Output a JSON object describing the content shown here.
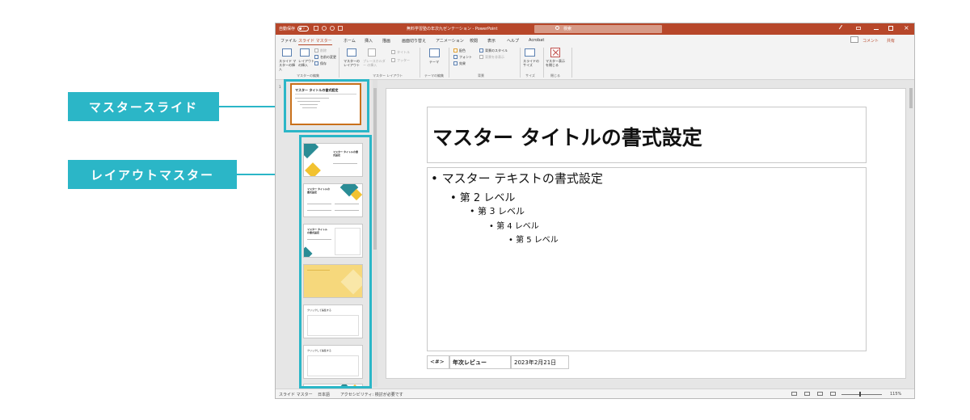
{
  "callouts": {
    "master_slide": "マスタースライド",
    "layout_master": "レイアウトマスター"
  },
  "colors": {
    "accent": "#2bb6c7",
    "titlebar": "#b7472a",
    "selected_thumb_border": "#c9711b"
  },
  "titlebar": {
    "autosave_label": "自動保存",
    "autosave_state": "オフ",
    "doc_title": "無料学習塾の年次九ゼンテーション - PowerPoint",
    "search_placeholder": "検索"
  },
  "menu": {
    "tabs": [
      "ファイル",
      "スライド マスター",
      "ホーム",
      "挿入",
      "描画",
      "画面切り替え",
      "アニメーション",
      "校閲",
      "表示",
      "ヘルプ",
      "Acrobat"
    ],
    "active_tab": "スライド マスター",
    "comments": "コメント",
    "share": "共有"
  },
  "ribbon": {
    "insert_slide_master": "スライド マスターの挿入",
    "insert_layout": "レイアウト の挿入",
    "delete": "削除",
    "rename": "名前の変更",
    "preserve": "保存",
    "master_layout": "マスターの レイアウト",
    "insert_placeholder": "プレースホルダー の挿入",
    "title_check": "タイトル",
    "footer_check": "フッター",
    "themes": "テーマ",
    "colors": "配色",
    "fonts": "フォント",
    "effects": "効果",
    "background_styles": "背景のスタイル",
    "hide_background": "背景を非表示",
    "slide_size": "スライドの サイズ",
    "close_master": "マスター表示 を閉じる",
    "groups": {
      "edit_master": "マスターの編集",
      "master_layout": "マスター レイアウト",
      "edit_theme": "テーマの編集",
      "background": "背景",
      "size": "サイズ",
      "close": "閉じる"
    }
  },
  "thumbnails": {
    "master_title": "マスター タイトルの書式設定",
    "layout_title": "マスター タイトルの書式設定",
    "small_title": "クリックして編集する"
  },
  "slide": {
    "title": "マスター タイトルの書式設定",
    "bullets": [
      "• マスター テキストの書式設定",
      "• 第 2 レベル",
      "• 第 3 レベル",
      "• 第 4 レベル",
      "• 第 5 レベル"
    ],
    "footer": {
      "slide_number": "<#>",
      "text": "年次レビュー",
      "date": "2023年2月21日"
    }
  },
  "statusbar": {
    "view": "スライド マスター",
    "language": "日本語",
    "accessibility": "アクセシビリティ: 検討が必要です",
    "zoom": "115%"
  }
}
